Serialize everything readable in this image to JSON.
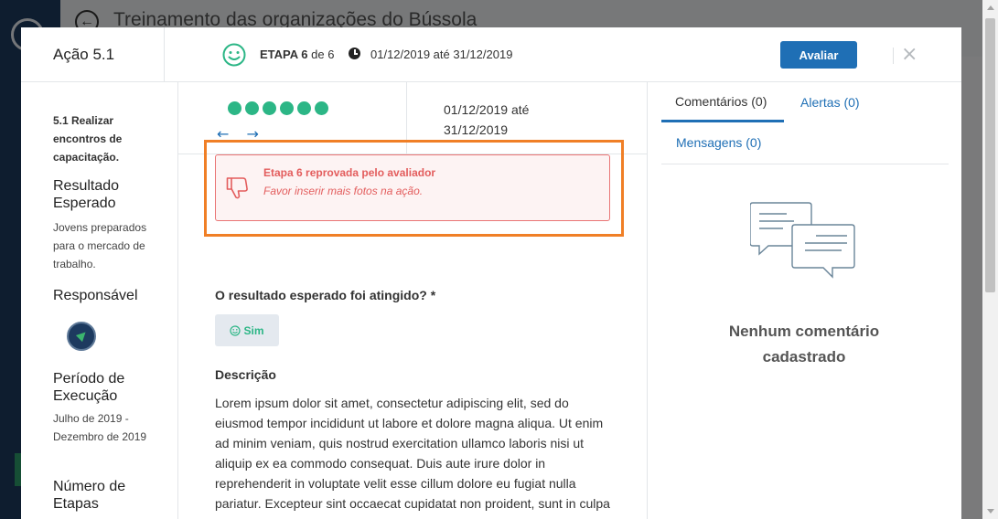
{
  "background": {
    "title": "Treinamento das organizações do Bússola"
  },
  "modal": {
    "action_title": "Ação 5.1",
    "etapa_label": "ETAPA 6",
    "etapa_of": "de 6",
    "header_dates": "01/12/2019 até 31/12/2019",
    "evaluate_button": "Avaliar",
    "close_glyph": "×"
  },
  "left": {
    "action_desc": "5.1 Realizar encontros de capacitação.",
    "resultado_head": "Resultado Esperado",
    "resultado_text": "Jovens preparados para o mercado de trabalho.",
    "responsavel_head": "Responsável",
    "periodo_head": "Período de Execução",
    "periodo_text": "Julho de 2019 - Dezembro de 2019",
    "numero_head": "Número de Etapas"
  },
  "middle": {
    "step_count": 6,
    "prev_arrow": "←",
    "next_arrow": "→",
    "dates": "01/12/2019 até 31/12/2019",
    "alert_title": "Etapa 6 reprovada pelo avaliador",
    "alert_message": "Favor inserir mais fotos na ação.",
    "question": "O resultado esperado foi atingido? *",
    "answer": "Sim",
    "description_label": "Descrição",
    "description_text": "Lorem ipsum dolor sit amet, consectetur adipiscing elit, sed do eiusmod tempor incididunt ut labore et dolore magna aliqua. Ut enim ad minim veniam, quis nostrud exercitation ullamco laboris nisi ut aliquip ex ea commodo consequat. Duis aute irure dolor in reprehenderit in voluptate velit esse cillum dolore eu fugiat nulla pariatur. Excepteur sint occaecat cupidatat non proident, sunt in culpa qui officia deserunt mollit anim id est laborum."
  },
  "right": {
    "tabs": [
      {
        "label": "Comentários (0)"
      },
      {
        "label": "Alertas (0)"
      },
      {
        "label": "Mensagens (0)"
      }
    ],
    "empty_message": "Nenhum comentário cadastrado"
  },
  "colors": {
    "primary": "#1f6fb5",
    "success": "#2cb686",
    "danger": "#e35d5d",
    "highlight": "#f07f26"
  },
  "icons": [
    "back-arrow-icon",
    "smiley-icon",
    "clock-icon",
    "close-icon",
    "thumbs-down-icon",
    "smile-icon",
    "chat-bubbles-icon"
  ]
}
